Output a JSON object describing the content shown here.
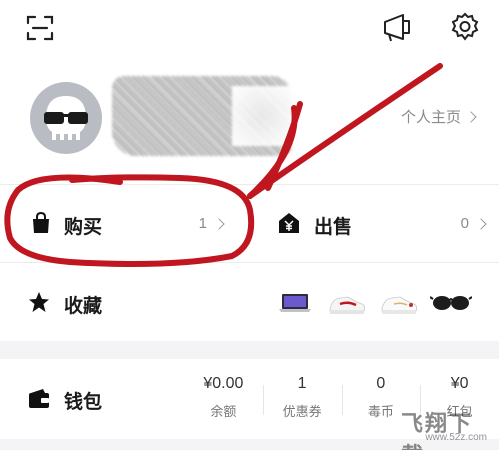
{
  "header": {
    "icons": [
      "scan-icon",
      "announcement-icon",
      "gear-icon"
    ]
  },
  "profile": {
    "homepage_label": "个人主页"
  },
  "trade": {
    "buy": {
      "label": "购买",
      "count": "1",
      "icon": "shopping-bag-icon"
    },
    "sell": {
      "label": "出售",
      "count": "0",
      "icon": "yen-house-icon"
    }
  },
  "favorites": {
    "label": "收藏",
    "icon": "star-icon",
    "thumbnails": [
      "laptop-thumbnail",
      "white-red-sneaker-thumbnail",
      "white-sneaker-thumbnail",
      "sunglasses-thumbnail"
    ]
  },
  "wallet": {
    "label": "钱包",
    "icon": "wallet-icon",
    "stats": [
      {
        "value": "¥0.00",
        "name": "余额"
      },
      {
        "value": "1",
        "name": "优惠券"
      },
      {
        "value": "0",
        "name": "毒币"
      },
      {
        "value": "¥0",
        "name": "红包"
      }
    ]
  },
  "watermark": {
    "text": "飞翔下载",
    "url": "www.52z.com"
  },
  "colors": {
    "annotation": "#c0161f",
    "text_primary": "#1a1a1a",
    "text_secondary": "#8a8a8a",
    "band": "#f4f4f6"
  }
}
